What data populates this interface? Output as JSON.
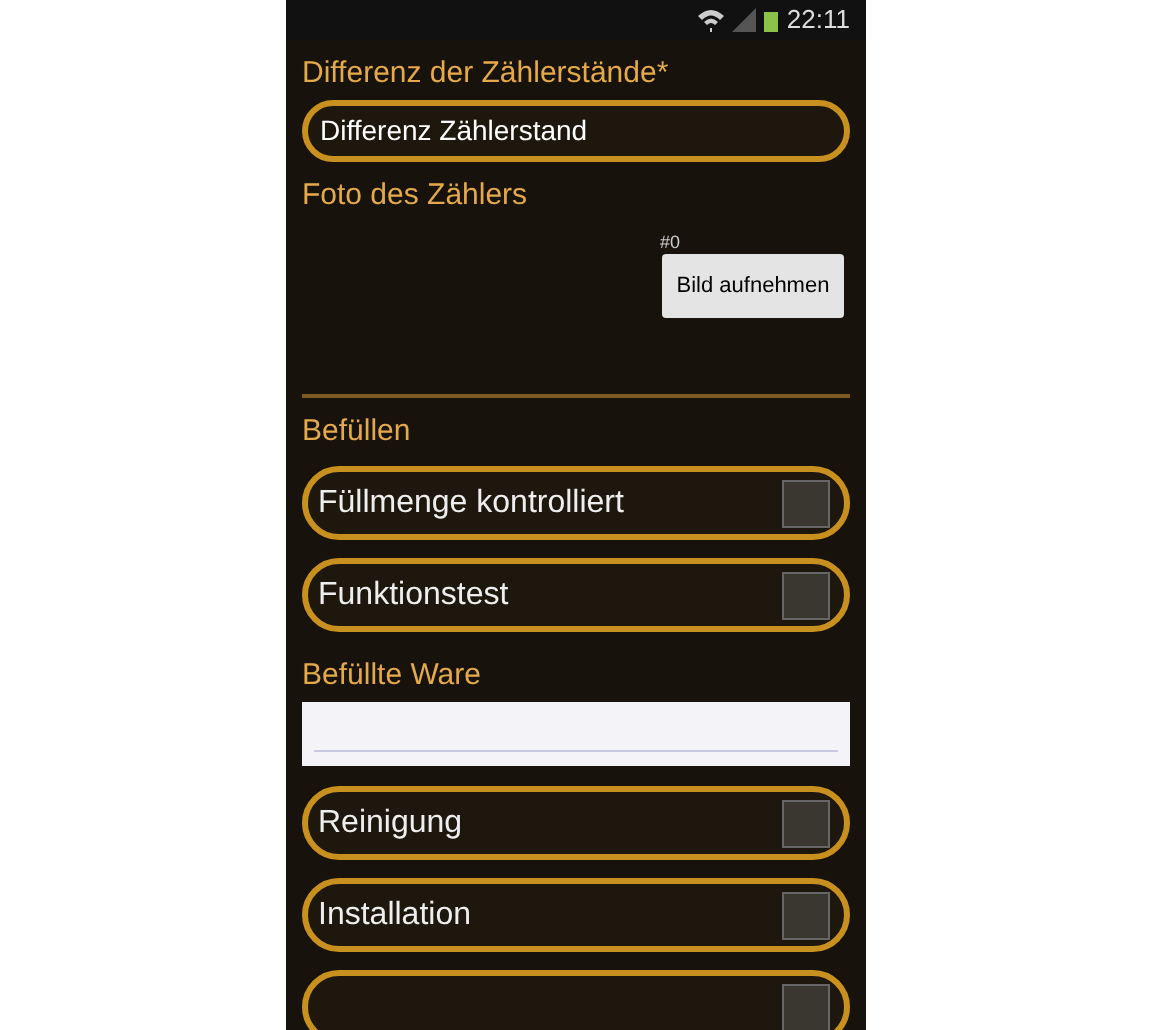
{
  "status_bar": {
    "time": "22:11"
  },
  "form": [
    {
      "kind": "label",
      "text": "Differenz der Zählerstände*"
    },
    {
      "kind": "pill_field",
      "value": "Differenz Zählerstand"
    },
    {
      "kind": "label",
      "text": "Foto des Zählers"
    },
    {
      "kind": "photo",
      "count": "#0",
      "button": "Bild aufnehmen"
    },
    {
      "kind": "divider"
    },
    {
      "kind": "label",
      "text": "Befüllen"
    },
    {
      "kind": "checkbox",
      "label": "Füllmenge kontrolliert",
      "checked": false
    },
    {
      "kind": "checkbox",
      "label": "Funktionstest",
      "checked": false
    },
    {
      "kind": "label",
      "text": "Befüllte Ware"
    },
    {
      "kind": "text_field"
    },
    {
      "kind": "checkbox",
      "label": "Reinigung",
      "checked": false
    },
    {
      "kind": "checkbox",
      "label": "Installation",
      "checked": false
    },
    {
      "kind": "checkbox",
      "checked": false
    }
  ]
}
